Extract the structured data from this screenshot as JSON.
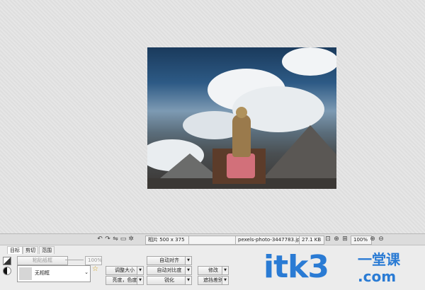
{
  "status": {
    "label_photo": "相片 500 x 375",
    "filename": "pexels-photo-3447783.jpeg",
    "filesize": "27.1 KB",
    "zoom": "100%"
  },
  "tabs": [
    {
      "label": "目标"
    },
    {
      "label": "剪切"
    },
    {
      "label": "范围"
    }
  ],
  "left": {
    "brush_label": "粘贴纸框",
    "slider_pct": "100%",
    "frame_value": "无相框"
  },
  "buttons": {
    "auto_align": "自动对齐",
    "resize": "调整大小",
    "auto_contrast": "自动对比度",
    "brightness_color": "亮度，色度",
    "sharpen": "锐化",
    "modify": "修改",
    "remove_diff": "遮挡差别"
  },
  "watermark": {
    "main": "itk3",
    "cn": "一堂课",
    "com": ".com"
  }
}
